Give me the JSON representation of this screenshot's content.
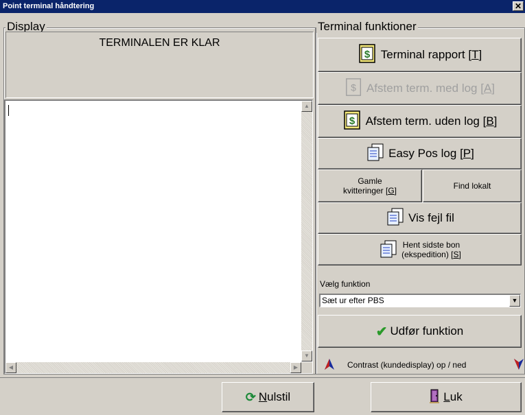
{
  "window": {
    "title": "Point terminal håndtering",
    "close_glyph": "✕"
  },
  "display": {
    "group_label": "Display",
    "message": "TERMINALEN ER KLAR"
  },
  "functions": {
    "group_label": "Terminal funktioner",
    "terminal_rapport": {
      "text": "Terminal rapport [",
      "key": "T",
      "end": "]"
    },
    "afstem_med_log": {
      "text": "Afstem term. med log [",
      "key": "A",
      "end": "]"
    },
    "afstem_uden_log": {
      "text": "Afstem term. uden log [",
      "key": "B",
      "end": "]"
    },
    "easy_pos_log": {
      "text": "Easy Pos log [",
      "key": "P",
      "end": "]"
    },
    "gamle_kvitteringer": {
      "line1": "Gamle",
      "line2": "kvitteringer [",
      "key": "G",
      "end": "]"
    },
    "find_lokalt": "Find lokalt",
    "vis_fejl_fil": "Vis fejl fil",
    "hent_sidste_bon": {
      "line1": "Hent sidste bon",
      "line2": "(ekspedition) [",
      "key": "S",
      "end": "]"
    }
  },
  "select": {
    "label": "Vælg funktion",
    "value": "Sæt ur efter PBS"
  },
  "udfor": {
    "label": "Udfør funktion"
  },
  "contrast": {
    "label": "Contrast (kundedisplay) op / ned"
  },
  "bottom": {
    "nulstil": {
      "key": "N",
      "rest": "ulstil"
    },
    "luk": {
      "key": "L",
      "rest": "uk"
    }
  },
  "colors": {
    "title_bg": "#0a246a",
    "face": "#d4d0c8",
    "check_green": "#2a9a2a",
    "refresh_green": "#1e8a3a",
    "arrow_blue": "#1a2a9a"
  },
  "icons": [
    "report-icon",
    "document-icon",
    "refresh-icon",
    "check-icon",
    "arrow-up-icon",
    "arrow-down-icon",
    "close-icon",
    "door-icon"
  ]
}
